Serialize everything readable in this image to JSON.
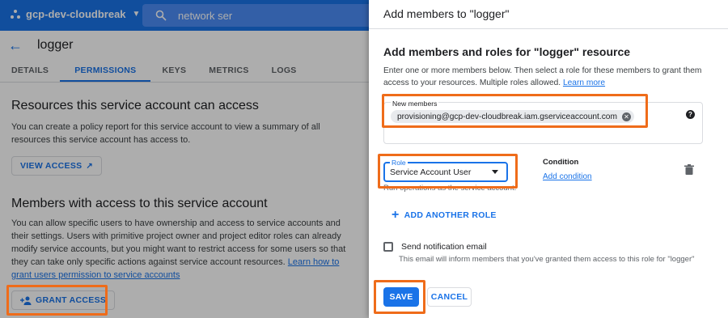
{
  "colors": {
    "brand": "#1a73e8",
    "highlight": "#ef6c1a",
    "overlay": "rgba(0,0,0,0.32)"
  },
  "topbar": {
    "project_name": "gcp-dev-cloudbreak",
    "project_icon": "hexagon-dots-icon",
    "dropdown_icon": "caret-down-icon",
    "search_value": "network ser",
    "search_icon": "search-icon"
  },
  "header": {
    "back_icon": "arrow-left-icon",
    "title": "logger"
  },
  "tabs": [
    {
      "label": "DETAILS",
      "active": false
    },
    {
      "label": "PERMISSIONS",
      "active": true
    },
    {
      "label": "KEYS",
      "active": false
    },
    {
      "label": "METRICS",
      "active": false
    },
    {
      "label": "LOGS",
      "active": false
    }
  ],
  "resources_section": {
    "heading": "Resources this service account can access",
    "body": "You can create a policy report for this service account to view a summary of all resources this service account has access to.",
    "button_label": "VIEW ACCESS",
    "button_icon": "open-in-new-icon"
  },
  "members_section": {
    "heading": "Members with access to this service account",
    "body": "You can allow specific users to have ownership and access to service accounts and their settings. Users with primitive project owner and project editor roles can already modify service accounts, but you might want to restrict access for some users so that they can take only specific actions against service account resources. ",
    "link": "Learn how to grant users permission to service accounts",
    "button_label": "GRANT ACCESS",
    "button_icon": "person-add-icon"
  },
  "panel": {
    "title": "Add members to \"logger\"",
    "heading": "Add members and roles for \"logger\" resource",
    "description": "Enter one or more members below. Then select a role for these members to grant them access to your resources. Multiple roles allowed. ",
    "learn_more": "Learn more",
    "new_members_label": "New members",
    "member_chip": "provisioning@gcp-dev-cloudbreak.iam.gserviceaccount.com",
    "help_icon": "help-circle-icon",
    "role_label": "Role",
    "role_value": "Service Account User",
    "role_description": "Run operations as the service account.",
    "condition_label": "Condition",
    "add_condition": "Add condition",
    "delete_icon": "trash-icon",
    "add_another_role": "ADD ANOTHER ROLE",
    "send_notification": "Send notification email",
    "notification_desc": "This email will inform members that you've granted them access to this role for \"logger\"",
    "save": "SAVE",
    "cancel": "CANCEL"
  }
}
